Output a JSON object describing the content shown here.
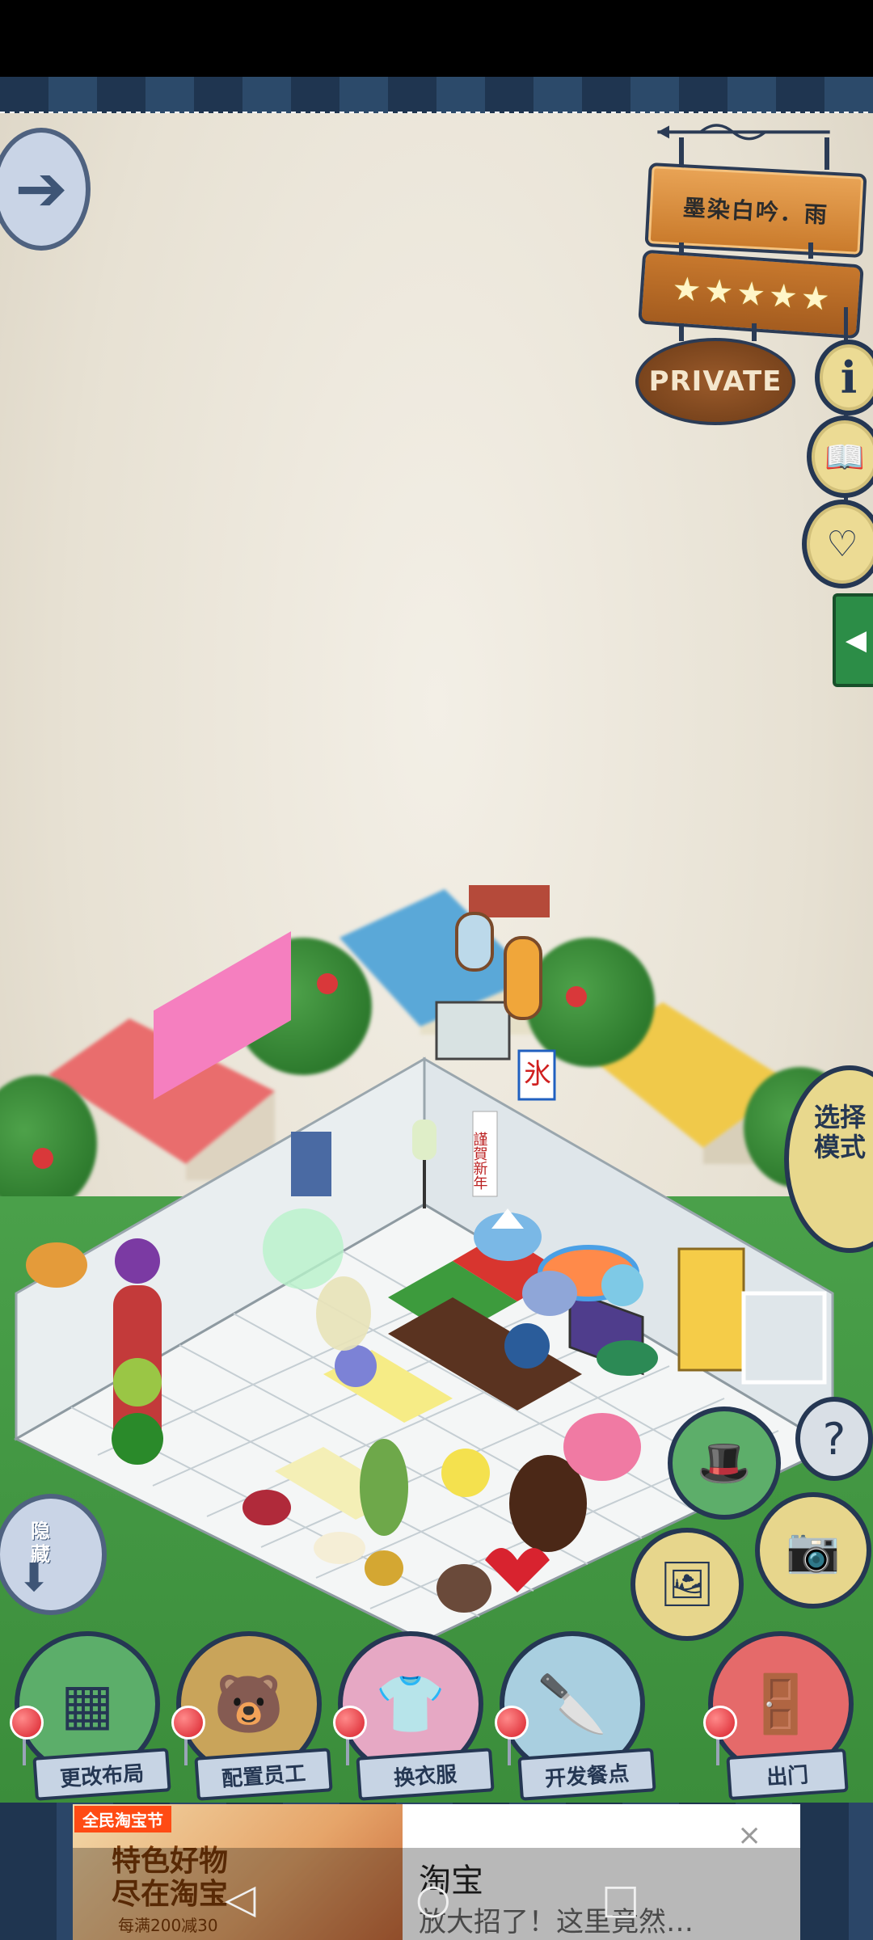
{
  "restaurant": {
    "name": "墨染白吟．雨",
    "stars": 5,
    "privacy_label": "PRIVATE"
  },
  "side_buttons": {
    "info_icon": "i",
    "menu_book_icon": "book-icon",
    "heart_icon": "heart-icon",
    "collapse_tab_icon": "◀"
  },
  "mode": {
    "select_mode_label": "选择模式"
  },
  "hide_button": {
    "label": "隐藏"
  },
  "room_decor": {
    "banner_text": "謹賀新年",
    "shaved_ice_sign": "氷"
  },
  "tools": {
    "help_icon": "?"
  },
  "actions": [
    {
      "label": "更改布局",
      "icon": "table-icon",
      "color": "#5cae6a"
    },
    {
      "label": "配置员工",
      "icon": "bear-icon",
      "color": "#c9a45a"
    },
    {
      "label": "换衣服",
      "icon": "shirt-icon",
      "color": "#e6a8c4"
    },
    {
      "label": "开发餐点",
      "icon": "knife-icon",
      "color": "#a9cfe0"
    },
    {
      "label": "出门",
      "icon": "door-icon",
      "color": "#e56a6a"
    }
  ],
  "ad": {
    "badge": "全民淘宝节",
    "slogan": "特色好物\n尽在淘宝",
    "price_note": "每满200减30",
    "title": "淘宝",
    "description": "放大招了！这里竟然…",
    "close_icon": "×"
  },
  "system_nav": {
    "back_icon": "◁",
    "home_icon": "○",
    "recents_icon": "□"
  }
}
